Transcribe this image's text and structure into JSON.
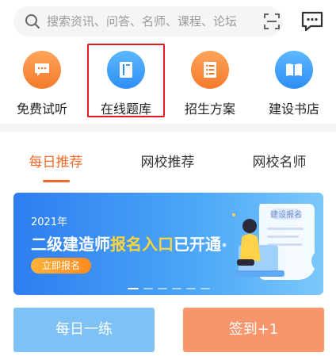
{
  "search": {
    "placeholder": "搜索资讯、问答、名师、课程、论坛"
  },
  "icons": {
    "search": "search-icon",
    "scan": "scan-icon",
    "message": "message-icon"
  },
  "entries": [
    {
      "label": "免费试听",
      "icon": "chat-icon",
      "color": "orange"
    },
    {
      "label": "在线题库",
      "icon": "notebook-icon",
      "color": "blue",
      "highlighted": true
    },
    {
      "label": "招生方案",
      "icon": "list-document-icon",
      "color": "orange"
    },
    {
      "label": "建设书店",
      "icon": "open-book-icon",
      "color": "blue"
    }
  ],
  "tabs": [
    {
      "label": "每日推荐",
      "active": true
    },
    {
      "label": "网校推荐",
      "active": false
    },
    {
      "label": "网校名师",
      "active": false
    }
  ],
  "banner": {
    "year": "2021年",
    "title_part1": "二级建造师",
    "title_highlight": "报名入口",
    "title_part2": "已开通",
    "button": "立即报名",
    "paper_text": "建设报名",
    "slide_count": 6,
    "active_slide": 1
  },
  "actions": {
    "daily": "每日一练",
    "sign": "签到+1"
  },
  "colors": {
    "accent_orange": "#f26a2a",
    "accent_blue": "#2f8ef5",
    "highlight_red": "#e4181e"
  }
}
